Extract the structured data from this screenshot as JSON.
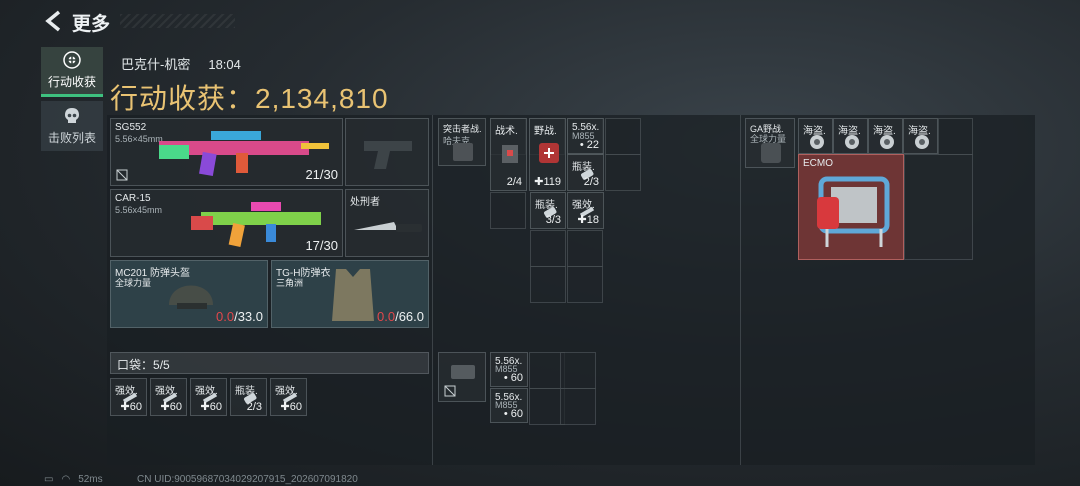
{
  "header": {
    "title": "更多"
  },
  "sidebar": {
    "tabs": [
      {
        "label": "行动收获",
        "icon": "loot-icon",
        "active": true
      },
      {
        "label": "击败列表",
        "icon": "skull-icon",
        "active": false
      }
    ]
  },
  "match": {
    "map": "巴克什-机密",
    "time": "18:04"
  },
  "loot": {
    "title": "行动收获：2,134,810"
  },
  "weapons": [
    {
      "name": "SG552",
      "caliber": "5.56×45mm",
      "ammo": "21/30",
      "icon": "rifle-icon"
    },
    {
      "name": "CAR-15",
      "caliber": "5.56x45mm",
      "ammo": "17/30",
      "icon": "rifle-icon"
    }
  ],
  "sidearm": {
    "icon": "pistol-icon"
  },
  "melee": {
    "name": "处刑者",
    "icon": "knife-icon"
  },
  "armor": [
    {
      "name": "MC201 防弹头盔",
      "maker": "全球力量",
      "dur_cur": "0.0",
      "dur_max": "/33.0",
      "icon": "helmet-icon"
    },
    {
      "name": "TG-H防弹衣",
      "maker": "三角洲",
      "dur_cur": "0.0",
      "dur_max": "/66.0",
      "icon": "vest-icon"
    }
  ],
  "pocket": {
    "label": "口袋：",
    "count": "5/5",
    "items": [
      {
        "name": "强效.",
        "count": "60",
        "icon": "syringe-icon"
      },
      {
        "name": "强效.",
        "count": "60",
        "icon": "syringe-icon"
      },
      {
        "name": "强效.",
        "count": "60",
        "icon": "syringe-icon"
      },
      {
        "name": "瓶装.",
        "count": "2/3",
        "icon": "bottle-icon"
      },
      {
        "name": "强效.",
        "count": "60",
        "icon": "syringe-icon"
      }
    ]
  },
  "rig": {
    "main": {
      "name": "突击者战.",
      "sub": "哈夫克",
      "icon": "chest-rig-icon"
    },
    "items": [
      {
        "name": "战术.",
        "count": "2/4",
        "icon": "tactical-kit-icon"
      },
      {
        "name": "野战.",
        "count": "119",
        "icon": "medkit-icon"
      },
      {
        "name": "5.56x.",
        "sub": "M855",
        "count": "22",
        "icon": "ammo-icon"
      },
      {
        "name": "瓶装.",
        "count": "2/3",
        "icon": "bottle-icon"
      },
      {
        "name": "瓶装.",
        "count": "3/3",
        "icon": "bottle-icon"
      },
      {
        "name": "强效.",
        "count": "18",
        "icon": "syringe-icon"
      }
    ]
  },
  "pouch": {
    "icon": "pouch-icon",
    "items": [
      {
        "name": "5.56x.",
        "sub": "M855",
        "count": "60",
        "icon": "ammo-icon"
      },
      {
        "name": "5.56x.",
        "sub": "M855",
        "count": "60",
        "icon": "ammo-icon"
      }
    ]
  },
  "backpack": {
    "main": {
      "name": "GA野战.",
      "sub": "全球力量",
      "icon": "backpack-icon"
    },
    "coins": [
      {
        "name": "海盗.",
        "icon": "coin-icon"
      },
      {
        "name": "海盗.",
        "icon": "coin-icon"
      },
      {
        "name": "海盗.",
        "icon": "coin-icon"
      },
      {
        "name": "海盗.",
        "icon": "coin-icon"
      }
    ],
    "ecmo": {
      "name": "ECMO",
      "icon": "ecmo-machine-icon"
    }
  },
  "status": {
    "ping": "52ms",
    "uid": "CN UID:90059687034029207915_202607091820"
  },
  "colors": {
    "gold": "#e9c373",
    "green": "#3ec17f",
    "red": "#e2474b",
    "ecmo_bg": "#6e3535"
  }
}
